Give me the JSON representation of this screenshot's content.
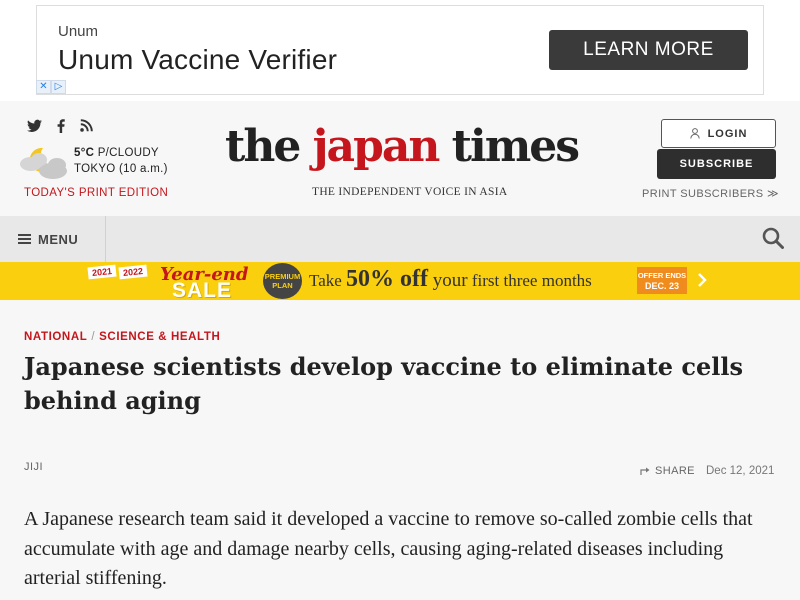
{
  "ad": {
    "brand": "Unum",
    "title": "Unum Vaccine Verifier",
    "cta": "LEARN MORE",
    "badge_icons": [
      "close-icon",
      "adchoices-icon"
    ]
  },
  "header": {
    "social_icons": [
      "twitter-icon",
      "facebook-icon",
      "rss-icon"
    ],
    "weather": {
      "temp": "5°C",
      "condition": "P/CLOUDY",
      "location": "TOKYO (10 a.m.)"
    },
    "print_edition": "TODAY'S PRINT EDITION",
    "logo": {
      "part1": "the ",
      "part2": "japan",
      "part3": " times"
    },
    "tagline": "THE INDEPENDENT VOICE IN ASIA",
    "login": "LOGIN",
    "subscribe": "SUBSCRIBE",
    "print_subscribers": "PRINT SUBSCRIBERS ≫"
  },
  "nav": {
    "menu": "MENU"
  },
  "banner": {
    "tag1": "2021",
    "tag2": "2022",
    "year_end": "Year-end",
    "sale": "SALE",
    "premium": "PREMIUM PLAN",
    "offer_pre": "Take ",
    "offer_big": "50% off",
    "offer_mid": " your",
    "offer_post": " first three months",
    "offer_ends_label": "OFFER ENDS",
    "offer_ends_date": "DEC. 23"
  },
  "article": {
    "category1": "NATIONAL",
    "category_sep": "/",
    "category2": "SCIENCE & HEALTH",
    "headline": "Japanese scientists develop vaccine to eliminate cells behind aging",
    "byline": "JIJI",
    "share": "SHARE",
    "date": "Dec 12, 2021",
    "body": "A Japanese research team said it developed a vaccine to remove so-called zombie cells that accumulate with age and damage nearby cells, causing aging-related diseases including arterial stiffening."
  },
  "colors": {
    "brand_red": "#c4161c",
    "banner_yellow": "#f9cf0e",
    "dark_button": "#2e2e2e"
  }
}
